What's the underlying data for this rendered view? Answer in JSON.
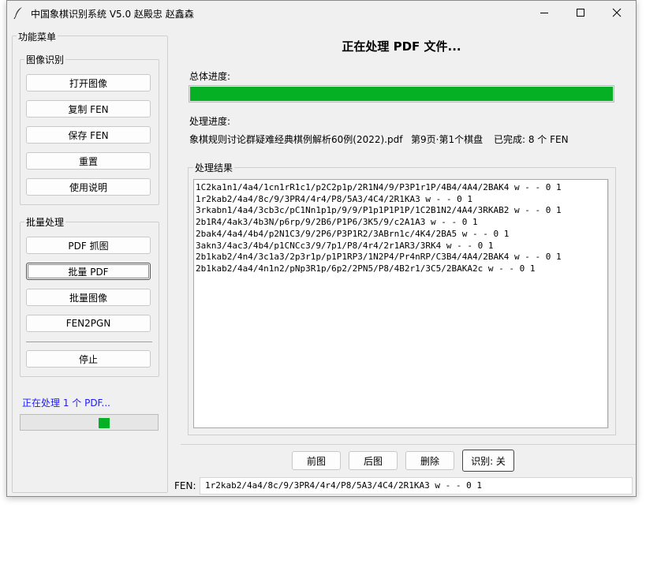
{
  "window": {
    "title": "中国象棋识别系统 V5.0  赵殿忠 赵鑫森"
  },
  "left_panel": {
    "title": "功能菜单",
    "image_group": {
      "title": "图像识别",
      "buttons": [
        "打开图像",
        "复制 FEN",
        "保存 FEN",
        "重置",
        "使用说明"
      ]
    },
    "batch_group": {
      "title": "批量处理",
      "buttons": [
        "PDF 抓图",
        "批量 PDF",
        "批量图像",
        "FEN2PGN"
      ],
      "stop_button": "停止"
    },
    "status_text": "正在处理 1 个 PDF...",
    "status_color": "#1a1aff"
  },
  "main": {
    "heading": "正在处理 PDF 文件...",
    "overall_label": "总体进度:",
    "overall_progress": 1.0,
    "process_label": "处理进度:",
    "process_file": "象棋规则讨论群疑难经典棋例解析60例(2022).pdf",
    "process_position": "第9页·第1个棋盘",
    "process_done": "已完成: 8 个 FEN",
    "results_label": "处理结果",
    "results": [
      "1C2ka1n1/4a4/1cn1rR1c1/p2C2p1p/2R1N4/9/P3P1r1P/4B4/4A4/2BAK4 w - - 0 1",
      "1r2kab2/4a4/8c/9/3PR4/4r4/P8/5A3/4C4/2R1KA3 w - - 0 1",
      "3rkabn1/4a4/3cb3c/pC1Nn1p1p/9/9/P1p1P1P1P/1C2B1N2/4A4/3RKAB2 w - - 0 1",
      "2b1R4/4ak3/4b3N/p6rp/9/2B6/P1P6/3K5/9/c2A1A3 w - - 0 1",
      "2bak4/4a4/4b4/p2N1C3/9/2P6/P3P1R2/3ABrn1c/4K4/2BA5 w - - 0 1",
      "3akn3/4ac3/4b4/p1CNCc3/9/7p1/P8/4r4/2r1AR3/3RK4 w - - 0 1",
      "2b1kab2/4n4/3c1a3/2p3r1p/p1P1RP3/1N2P4/Pr4nRP/C3B4/4A4/2BAK4 w - - 0 1",
      "2b1kab2/4a4/4n1n2/pNp3R1p/6p2/2PN5/P8/4B2r1/3C5/2BAKA2c w - - 0 1"
    ],
    "nav_buttons": [
      "前图",
      "后图",
      "删除",
      "识别: 关"
    ],
    "fen_label": "FEN:",
    "fen_value": "1r2kab2/4a4/8c/9/3PR4/4r4/P8/5A3/4C4/2R1KA3 w - - 0 1",
    "progress_color": "#06b025"
  }
}
